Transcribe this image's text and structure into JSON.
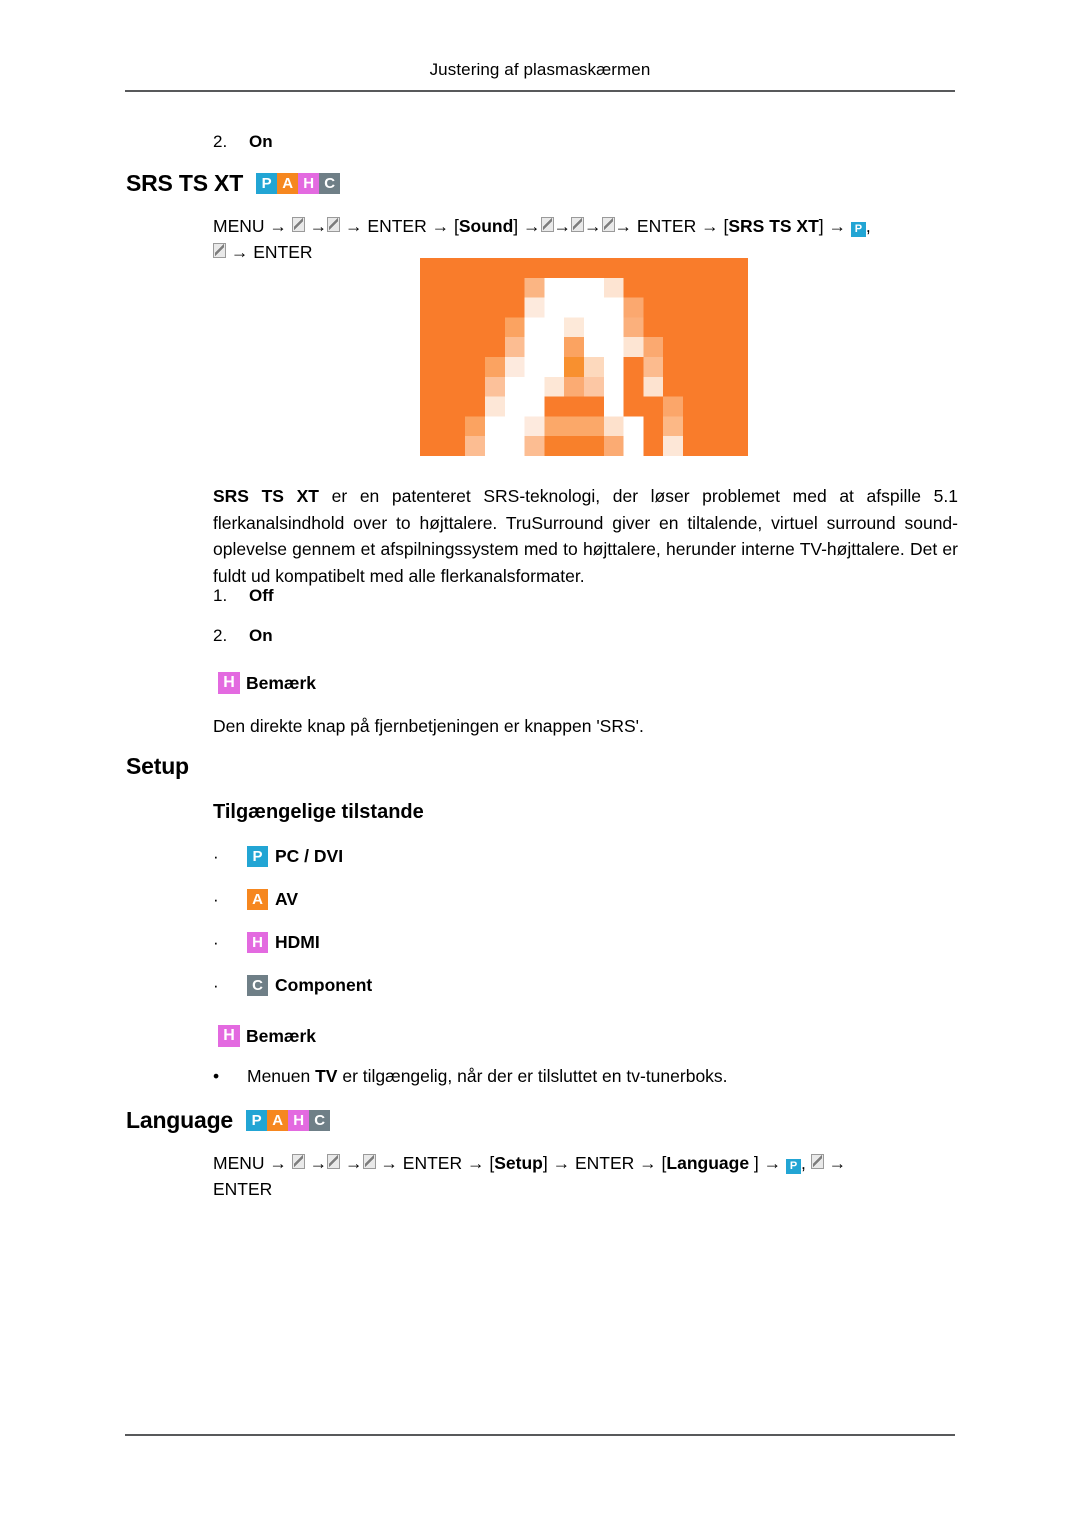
{
  "page": {
    "running_head": "Justering af plasmaskærmen"
  },
  "colors": {
    "badge_pc": "#22a5d4",
    "badge_av": "#f6871f",
    "badge_hdmi": "#e36ae0",
    "badge_component": "#6f7f87",
    "figure_background": "#f97c2b",
    "rule": "#58595b"
  },
  "top_list": {
    "item": {
      "num": "2.",
      "value": "On"
    }
  },
  "srs": {
    "heading": "SRS TS XT",
    "badges": [
      "P",
      "A",
      "H",
      "C"
    ],
    "navpath": {
      "l1_a": "MENU",
      "arrow": "→",
      "l1_b": "ENTER",
      "l1_bracket_open": "[",
      "l1_label": "Sound",
      "l1_bracket_close": "]",
      "l1_c": "ENTER",
      "l2_bracket_open": "[",
      "l2_label": "SRS TS XT",
      "l2_bracket_close": "]",
      "badge_p": "P",
      "comma": ",",
      "l3_enter": "ENTER"
    },
    "figure_alt_letter": "A",
    "paragraph_bold_lead": "SRS TS XT",
    "paragraph": " er en patenteret SRS-teknologi, der løser problemet med at afspille 5.1 flerkanalsindhold over to højttalere. TruSurround giver en tiltalende, virtuel surround sound-oplevelse gennem et afspilningssystem med to højttalere, herunder interne TV-højttalere. Det er fuldt ud kompatibelt med alle flerkanalsformater.",
    "options": [
      {
        "num": "1.",
        "value": "Off"
      },
      {
        "num": "2.",
        "value": "On"
      }
    ],
    "note": {
      "badge": "H",
      "title": "Bemærk",
      "text": "Den direkte knap på fjernbetjeningen er knappen 'SRS'."
    }
  },
  "setup": {
    "heading": "Setup",
    "subheading": "Tilgængelige tilstande",
    "modes": [
      {
        "badge": "P",
        "badge_class": "b-p",
        "label": "PC / DVI"
      },
      {
        "badge": "A",
        "badge_class": "b-a",
        "label": "AV"
      },
      {
        "badge": "H",
        "badge_class": "b-h",
        "label": "HDMI"
      },
      {
        "badge": "C",
        "badge_class": "b-c",
        "label": "Component"
      }
    ],
    "note": {
      "badge": "H",
      "title": "Bemærk",
      "bullet_lead": "Menuen ",
      "bullet_bold": "TV",
      "bullet_tail": " er tilgængelig, når der er tilsluttet en tv-tunerboks."
    }
  },
  "language": {
    "heading": "Language",
    "badges": [
      "P",
      "A",
      "H",
      "C"
    ],
    "navpath": {
      "menu": "MENU",
      "enter1": "ENTER",
      "bracket_open": "[",
      "label_setup": "Setup",
      "bracket_close": "]",
      "enter2": "ENTER",
      "bracket_open2": "[",
      "label_language": "Language ",
      "bracket_close2": "]",
      "badge_p": "P",
      "comma": ",",
      "enter3": "ENTER"
    }
  }
}
